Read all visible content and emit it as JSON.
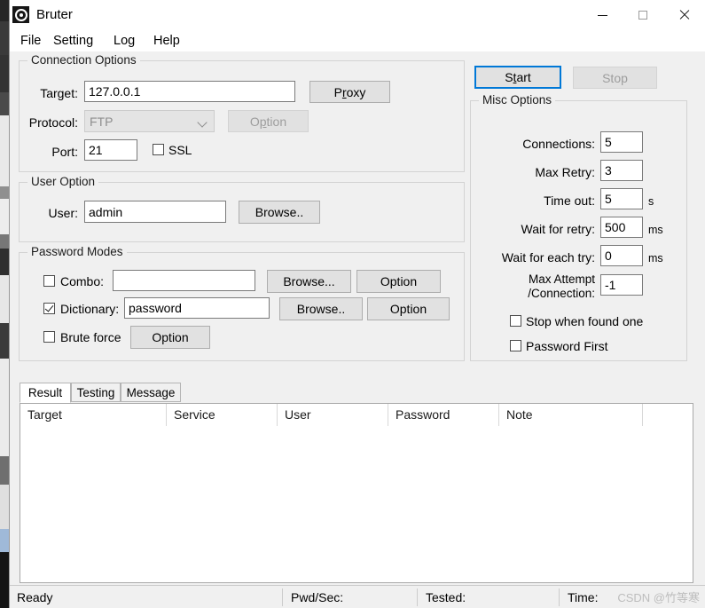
{
  "window": {
    "title": "Bruter",
    "icon": "bullseye-icon",
    "controls": {
      "minimize": "—",
      "maximize": "□",
      "close": "✕"
    }
  },
  "menu": {
    "items": [
      {
        "label": "File"
      },
      {
        "label": "Setting"
      },
      {
        "label": "Log"
      },
      {
        "label": "Help"
      }
    ]
  },
  "connection_options": {
    "title": "Connection Options",
    "target_label": "Target:",
    "target_value": "127.0.0.1",
    "proxy_button": {
      "pre": "P",
      "accel": "r",
      "post": "oxy"
    },
    "protocol_label": "Protocol:",
    "protocol_value": "FTP",
    "protocol_option_button": {
      "pre": "O",
      "accel": "p",
      "post": "tion"
    },
    "port_label": "Port:",
    "port_value": "21",
    "ssl_label": "SSL",
    "ssl_checked": false
  },
  "user_option": {
    "title": "User Option",
    "user_label": "User:",
    "user_value": "admin",
    "browse_button": "Browse.."
  },
  "password_modes": {
    "title": "Password Modes",
    "combo": {
      "label": "Combo:",
      "checked": false,
      "value": "",
      "placeholder": "",
      "browse_button": "Browse...",
      "option_button": "Option"
    },
    "dictionary": {
      "label": "Dictionary:",
      "checked": true,
      "value": "password",
      "browse_button": "Browse..",
      "option_button": "Option"
    },
    "brute_force": {
      "label": "Brute force",
      "checked": false,
      "option_button": "Option"
    }
  },
  "actions": {
    "start_button": {
      "pre": "S",
      "accel": "t",
      "post": "art"
    },
    "stop_button": "Stop"
  },
  "misc_options": {
    "title": "Misc Options",
    "fields": [
      {
        "label": "Connections:",
        "value": "5",
        "unit": ""
      },
      {
        "label": "Max Retry:",
        "value": "3",
        "unit": ""
      },
      {
        "label": "Time out:",
        "value": "5",
        "unit": "s"
      },
      {
        "label": "Wait for retry:",
        "value": "500",
        "unit": "ms"
      },
      {
        "label": "Wait for each try:",
        "value": "0",
        "unit": "ms"
      }
    ],
    "max_attempt_label_line1": "Max Attempt",
    "max_attempt_label_line2": "/Connection:",
    "max_attempt_value": "-1",
    "checkboxes": [
      {
        "label": "Stop when found one",
        "checked": false
      },
      {
        "label": "Password First",
        "checked": false
      }
    ]
  },
  "results": {
    "tabs": [
      {
        "label": "Result",
        "active": true
      },
      {
        "label": "Testing",
        "active": false
      },
      {
        "label": "Message",
        "active": false
      }
    ],
    "columns": [
      "Target",
      "Service",
      "User",
      "Password",
      "Note",
      ""
    ],
    "rows": []
  },
  "statusbar": {
    "ready": "Ready",
    "pwd_sec": "Pwd/Sec:",
    "tested": "Tested:",
    "time": "Time:",
    "watermark": "CSDN @竹等寒"
  }
}
